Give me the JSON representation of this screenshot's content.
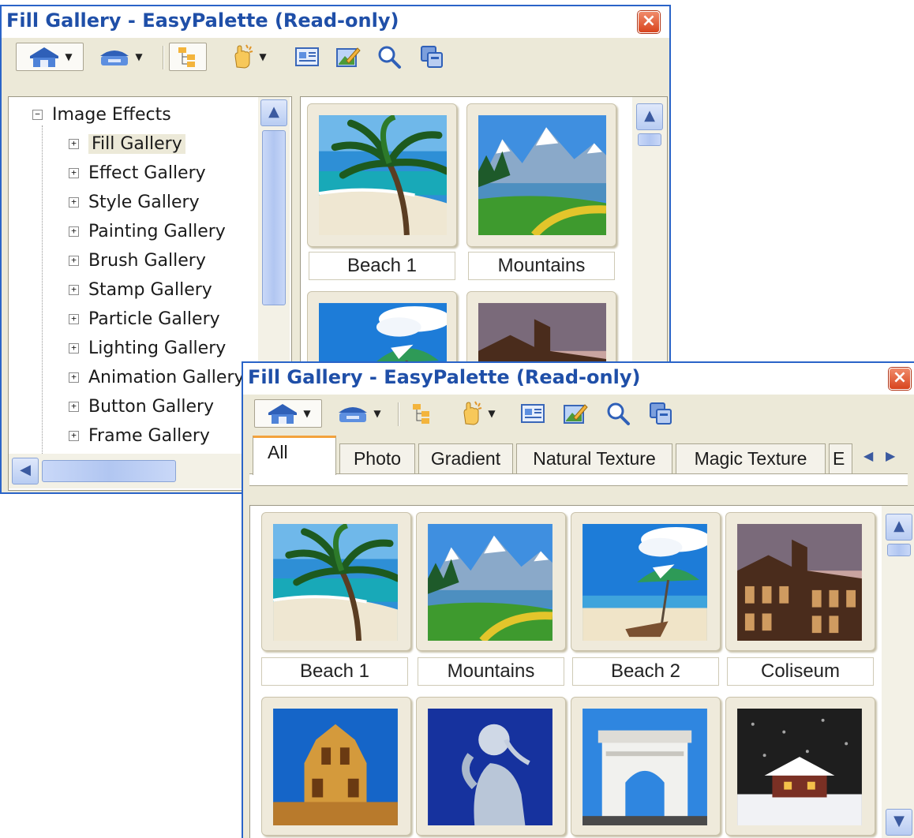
{
  "back_window": {
    "title": "Fill Gallery - EasyPalette (Read-only)",
    "close_glyph": "×",
    "tree": {
      "root_label": "Image Effects",
      "items": [
        {
          "label": "Fill Gallery",
          "selected": true
        },
        {
          "label": "Effect Gallery"
        },
        {
          "label": "Style Gallery"
        },
        {
          "label": "Painting Gallery"
        },
        {
          "label": "Brush Gallery"
        },
        {
          "label": "Stamp Gallery"
        },
        {
          "label": "Particle Gallery"
        },
        {
          "label": "Lighting Gallery"
        },
        {
          "label": "Animation Gallery"
        },
        {
          "label": "Button Gallery"
        },
        {
          "label": "Frame Gallery"
        }
      ]
    },
    "thumbnails": [
      {
        "caption": "Beach 1",
        "image": "beach-palm"
      },
      {
        "caption": "Mountains",
        "image": "mountain-lake"
      }
    ]
  },
  "front_window": {
    "title": "Fill Gallery - EasyPalette (Read-only)",
    "close_glyph": "×",
    "tabs": [
      "All",
      "Photo",
      "Gradient",
      "Natural Texture",
      "Magic Texture",
      "E"
    ],
    "active_tab": "All",
    "thumbnails": [
      {
        "caption": "Beach 1",
        "image": "beach-palm"
      },
      {
        "caption": "Mountains",
        "image": "mountain-lake"
      },
      {
        "caption": "Beach 2",
        "image": "beach-umbrella"
      },
      {
        "caption": "Coliseum",
        "image": "coliseum"
      },
      {
        "caption": "",
        "image": "cathedral-tower"
      },
      {
        "caption": "",
        "image": "statue"
      },
      {
        "caption": "",
        "image": "arch"
      },
      {
        "caption": "",
        "image": "snow-cabin"
      }
    ]
  },
  "icons": {
    "home": "home-icon",
    "category": "category-icon",
    "tree_view": "tree-view-icon",
    "hand": "hand-icon",
    "properties": "properties-icon",
    "edit": "edit-image-icon",
    "search": "search-icon",
    "copy": "copy-icon"
  },
  "colors": {
    "title_text": "#1f4fa8",
    "window_border": "#2a64c8",
    "window_bg": "#ece9d8",
    "close": "#d8451e",
    "tab_accent": "#f3a23c",
    "scroll": "#b8ccf2"
  }
}
